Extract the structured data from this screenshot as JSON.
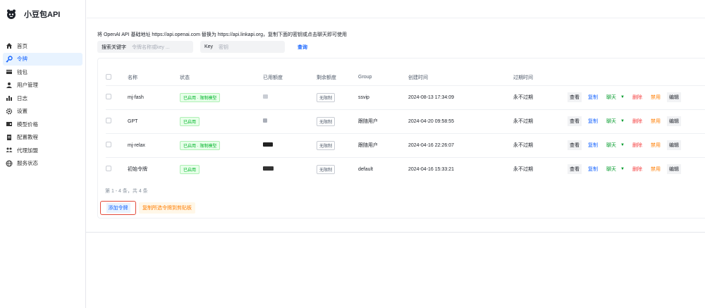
{
  "brand": {
    "name": "小豆包API"
  },
  "sidebar": {
    "items": [
      {
        "label": "首页",
        "icon": "home-icon"
      },
      {
        "label": "令牌",
        "icon": "key-icon",
        "active": true
      },
      {
        "label": "钱包",
        "icon": "wallet-icon"
      },
      {
        "label": "用户管理",
        "icon": "user-icon"
      },
      {
        "label": "日志",
        "icon": "chart-icon"
      },
      {
        "label": "设置",
        "icon": "gear-icon"
      },
      {
        "label": "模型价格",
        "icon": "price-icon"
      },
      {
        "label": "配置教程",
        "icon": "doc-icon"
      },
      {
        "label": "代理加盟",
        "icon": "team-icon"
      },
      {
        "label": "服务状态",
        "icon": "globe-icon"
      }
    ]
  },
  "notice": "将 OpenAI API 基础地址 https://api.openai.com 替换为 https://api.linkapi.org，复制下面的密钥或点击聊天即可使用",
  "search": {
    "keyword_label": "搜索关键字",
    "keyword_placeholder": "令牌名称或key ...",
    "key_label": "Key",
    "key_placeholder": "密钥",
    "query_label": "查询"
  },
  "table": {
    "headers": [
      "名称",
      "状态",
      "已用额度",
      "剩余额度",
      "Group",
      "创建时间",
      "过期时间"
    ],
    "rows": [
      {
        "name": "mj-fash",
        "status": "已启用 · 限制模型",
        "remaining": "无限制",
        "group": "ssvip",
        "created": "2024-08-13 17:34:09",
        "expires": "永不过期"
      },
      {
        "name": "GPT",
        "status": "已启用",
        "remaining": "无限制",
        "group": "跟随用户",
        "created": "2024-04-20 09:58:55",
        "expires": "永不过期"
      },
      {
        "name": "mj-relax",
        "status": "已启用 · 限制模型",
        "remaining": "无限制",
        "group": "跟随用户",
        "created": "2024-04-16 22:26:07",
        "expires": "永不过期"
      },
      {
        "name": "初始令牌",
        "status": "已启用",
        "remaining": "无限制",
        "group": "default",
        "created": "2024-04-16 15:33:21",
        "expires": "永不过期"
      }
    ],
    "actions": {
      "view": "查看",
      "copy": "复制",
      "chat": "聊天",
      "delete": "删除",
      "disable": "禁用",
      "edit": "编辑"
    }
  },
  "pager": "第 1 - 4 条，共 4 条",
  "buttons": {
    "add": "添加令牌",
    "copy_selected": "复制所选令牌到剪贴板"
  },
  "colors": {
    "accent": "#1664ff",
    "success": "#00b42a",
    "danger": "#f53f3f",
    "warning": "#ff7d00",
    "highlight_border": "#e34a3a"
  }
}
